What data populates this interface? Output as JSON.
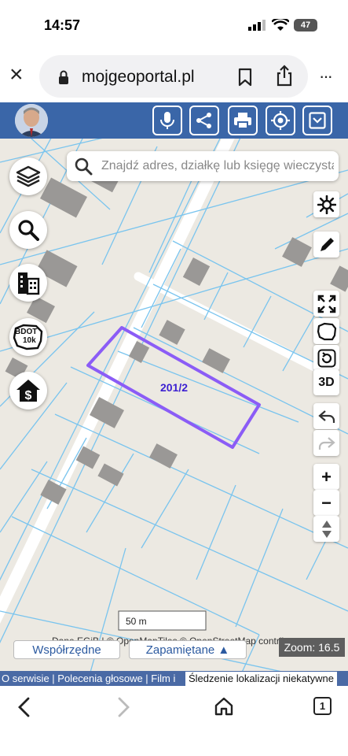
{
  "status_bar": {
    "time": "14:57",
    "battery": "47"
  },
  "browser": {
    "close_label": "×",
    "url": "mojgeoportal.pl",
    "more_label": "···"
  },
  "search": {
    "placeholder": "Znajdź adres, działkę lub księgę wieczystą"
  },
  "map": {
    "parcel_label": "201/2",
    "scale_label": "50 m",
    "zoom_label": "Zoom: 16.5",
    "attribution": "Dane EGiB | © OpenMapTiles © OpenStreetMap contributors",
    "parcel_color": "#8b5cf6",
    "parcel_line_color": "#4fb3e8"
  },
  "left_buttons": {
    "bdot_line1": "BDOT",
    "bdot_line2": "10k"
  },
  "right_buttons": {
    "three_d_label": "3D",
    "zoom_in_label": "+",
    "zoom_out_label": "−"
  },
  "bottom": {
    "coords_button": "Współrzędne",
    "saved_button": "Zapamiętane ▲",
    "footer_links": "O serwisie | Polecenia głosowe | Film i",
    "tracking_status": "Śledzenie lokalizacji niekatywne"
  },
  "navbar": {
    "tabs_count": "1"
  }
}
